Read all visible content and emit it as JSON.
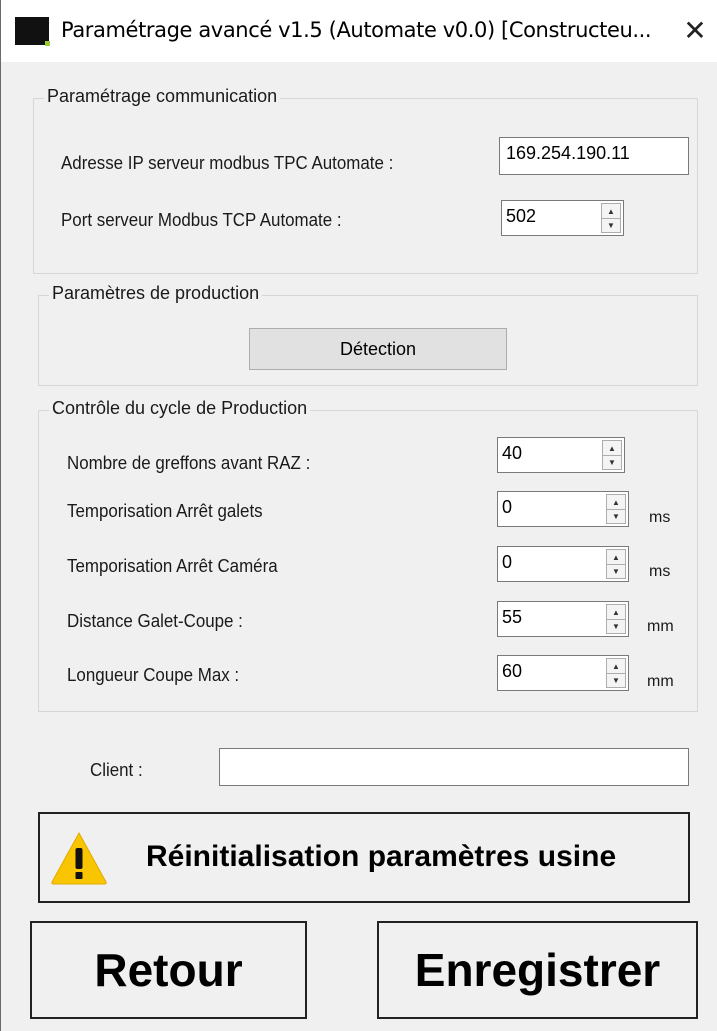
{
  "window": {
    "title": "Paramétrage avancé v1.5 (Automate v0.0) [Constructeu...",
    "close_glyph": "✕"
  },
  "communication": {
    "title": "Paramétrage communication",
    "ip_label": "Adresse IP serveur modbus TPC Automate :",
    "ip_value": "169.254.190.11",
    "port_label": "Port serveur Modbus TCP Automate :",
    "port_value": "502"
  },
  "production": {
    "title": "Paramètres de production",
    "detection_label": "Détection"
  },
  "cycle": {
    "title": "Contrôle du cycle de Production",
    "rows": [
      {
        "label": "Nombre de greffons avant RAZ :",
        "value": "40",
        "unit": ""
      },
      {
        "label": "Temporisation Arrêt galets",
        "value": "0",
        "unit": "ms"
      },
      {
        "label": "Temporisation Arrêt Caméra",
        "value": "0",
        "unit": "ms"
      },
      {
        "label": "Distance Galet-Coupe :",
        "value": "55",
        "unit": "mm"
      },
      {
        "label": "Longueur Coupe Max :",
        "value": "60",
        "unit": "mm"
      }
    ]
  },
  "client": {
    "label": "Client :",
    "value": ""
  },
  "reset": {
    "label": "Réinitialisation paramètres usine",
    "icon": "warning-icon",
    "icon_color": "#f9c400"
  },
  "buttons": {
    "back_label": "Retour",
    "save_label": "Enregistrer"
  }
}
